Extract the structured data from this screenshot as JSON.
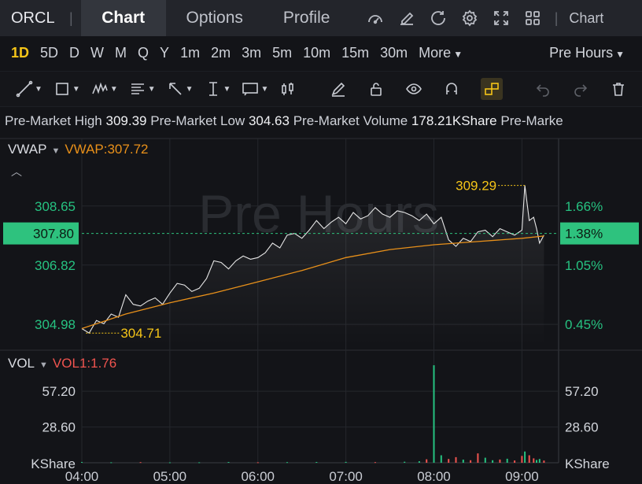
{
  "header": {
    "ticker": "ORCL",
    "tabs": [
      {
        "label": "Chart",
        "active": true
      },
      {
        "label": "Options",
        "active": false
      },
      {
        "label": "Profile",
        "active": false
      }
    ],
    "chart_link": "Chart"
  },
  "periods": {
    "items": [
      "1D",
      "5D",
      "D",
      "W",
      "M",
      "Q",
      "Y",
      "1m",
      "2m",
      "3m",
      "5m",
      "10m",
      "15m",
      "30m"
    ],
    "active": "1D",
    "more_label": "More",
    "session_label": "Pre Hours"
  },
  "info": {
    "high_label": "Pre-Market High",
    "high_value": "309.39",
    "low_label": "Pre-Market Low",
    "low_value": "304.63",
    "volume_label": "Pre-Market Volume",
    "volume_value": "178.21KShare",
    "trailing": "Pre-Marke"
  },
  "indicators": {
    "main_name": "VWAP",
    "main_value": "VWAP:307.72",
    "vol_name": "VOL",
    "vol_value": "VOL1:1.76"
  },
  "colors": {
    "accent": "#f5c518",
    "up": "#26c281",
    "down": "#f0544f",
    "vwap": "#e8901a",
    "price_line": "#e6e6e6",
    "current_tag": "#2ec27e"
  },
  "chart_data": {
    "type": "line",
    "watermark": "Pre Hours",
    "x_labels": [
      "04:00",
      "05:00",
      "06:00",
      "07:00",
      "08:00",
      "09:00"
    ],
    "price_axis_left": [
      "308.65",
      "306.82",
      "304.98"
    ],
    "price_axis_right": [
      "1.66%",
      "1.05%",
      "0.45%"
    ],
    "current_price": "307.80",
    "current_pct": "1.38%",
    "high_marker": "309.29",
    "low_marker": "304.71",
    "ylim": [
      304.3,
      310.5
    ],
    "price_series": [
      [
        "04:00",
        304.85
      ],
      [
        "04:05",
        304.71
      ],
      [
        "04:10",
        305.1
      ],
      [
        "04:15",
        305.0
      ],
      [
        "04:20",
        305.3
      ],
      [
        "04:25",
        305.2
      ],
      [
        "04:30",
        305.9
      ],
      [
        "04:35",
        305.6
      ],
      [
        "04:40",
        305.55
      ],
      [
        "04:45",
        305.7
      ],
      [
        "04:50",
        305.8
      ],
      [
        "04:55",
        305.6
      ],
      [
        "05:00",
        305.95
      ],
      [
        "05:05",
        306.25
      ],
      [
        "05:10",
        306.2
      ],
      [
        "05:15",
        306.0
      ],
      [
        "05:20",
        306.1
      ],
      [
        "05:25",
        306.4
      ],
      [
        "05:30",
        306.95
      ],
      [
        "05:35",
        306.9
      ],
      [
        "05:40",
        306.7
      ],
      [
        "05:45",
        306.95
      ],
      [
        "05:50",
        307.1
      ],
      [
        "05:55",
        307.0
      ],
      [
        "06:00",
        307.05
      ],
      [
        "06:05",
        307.2
      ],
      [
        "06:10",
        307.5
      ],
      [
        "06:15",
        307.35
      ],
      [
        "06:20",
        307.75
      ],
      [
        "06:25",
        307.8
      ],
      [
        "06:30",
        307.65
      ],
      [
        "06:35",
        307.9
      ],
      [
        "06:40",
        308.2
      ],
      [
        "06:45",
        307.95
      ],
      [
        "06:50",
        308.15
      ],
      [
        "06:55",
        308.3
      ],
      [
        "07:00",
        308.1
      ],
      [
        "07:05",
        308.45
      ],
      [
        "07:10",
        308.25
      ],
      [
        "07:15",
        308.35
      ],
      [
        "07:20",
        308.6
      ],
      [
        "07:25",
        308.4
      ],
      [
        "07:30",
        308.3
      ],
      [
        "07:35",
        308.5
      ],
      [
        "07:40",
        308.45
      ],
      [
        "07:45",
        308.35
      ],
      [
        "07:50",
        308.2
      ],
      [
        "07:55",
        308.4
      ],
      [
        "08:00",
        308.1
      ],
      [
        "08:05",
        308.3
      ],
      [
        "08:10",
        307.6
      ],
      [
        "08:15",
        307.4
      ],
      [
        "08:20",
        307.65
      ],
      [
        "08:25",
        307.55
      ],
      [
        "08:30",
        307.85
      ],
      [
        "08:35",
        307.9
      ],
      [
        "08:40",
        307.7
      ],
      [
        "08:45",
        307.95
      ],
      [
        "08:50",
        307.85
      ],
      [
        "08:55",
        307.75
      ],
      [
        "09:00",
        307.9
      ],
      [
        "09:02",
        309.29
      ],
      [
        "09:05",
        308.2
      ],
      [
        "09:08",
        308.3
      ],
      [
        "09:10",
        307.95
      ],
      [
        "09:12",
        307.5
      ],
      [
        "09:15",
        307.75
      ]
    ],
    "vwap_series": [
      [
        "04:00",
        304.85
      ],
      [
        "04:30",
        305.3
      ],
      [
        "05:00",
        305.65
      ],
      [
        "05:30",
        305.95
      ],
      [
        "06:00",
        306.3
      ],
      [
        "06:30",
        306.65
      ],
      [
        "07:00",
        307.05
      ],
      [
        "07:30",
        307.3
      ],
      [
        "08:00",
        307.45
      ],
      [
        "08:30",
        307.55
      ],
      [
        "09:00",
        307.65
      ],
      [
        "09:15",
        307.72
      ]
    ],
    "volume_axis": [
      "57.20",
      "28.60",
      "KShare"
    ],
    "vol_ylim": [
      0,
      85
    ],
    "volume_series": [
      [
        "04:00",
        0.6,
        "up"
      ],
      [
        "04:20",
        0.4,
        "up"
      ],
      [
        "04:40",
        0.5,
        "down"
      ],
      [
        "05:00",
        0.3,
        "up"
      ],
      [
        "05:20",
        0.4,
        "up"
      ],
      [
        "05:40",
        0.6,
        "up"
      ],
      [
        "06:00",
        0.4,
        "down"
      ],
      [
        "06:20",
        0.5,
        "up"
      ],
      [
        "06:40",
        0.6,
        "up"
      ],
      [
        "07:00",
        0.7,
        "up"
      ],
      [
        "07:20",
        0.5,
        "down"
      ],
      [
        "07:40",
        0.8,
        "up"
      ],
      [
        "07:50",
        1.2,
        "up"
      ],
      [
        "07:55",
        2.8,
        "down"
      ],
      [
        "08:00",
        78.0,
        "up"
      ],
      [
        "08:05",
        6.0,
        "up"
      ],
      [
        "08:10",
        3.0,
        "down"
      ],
      [
        "08:15",
        4.5,
        "down"
      ],
      [
        "08:20",
        2.5,
        "up"
      ],
      [
        "08:25",
        2.0,
        "down"
      ],
      [
        "08:30",
        7.5,
        "down"
      ],
      [
        "08:35",
        4.0,
        "up"
      ],
      [
        "08:40",
        2.0,
        "up"
      ],
      [
        "08:45",
        2.6,
        "down"
      ],
      [
        "08:50",
        3.2,
        "up"
      ],
      [
        "08:55",
        1.8,
        "down"
      ],
      [
        "09:00",
        5.5,
        "down"
      ],
      [
        "09:02",
        9.0,
        "up"
      ],
      [
        "09:05",
        6.0,
        "down"
      ],
      [
        "09:08",
        3.5,
        "down"
      ],
      [
        "09:10",
        2.2,
        "up"
      ],
      [
        "09:12",
        3.0,
        "up"
      ],
      [
        "09:15",
        1.76,
        "down"
      ]
    ]
  }
}
